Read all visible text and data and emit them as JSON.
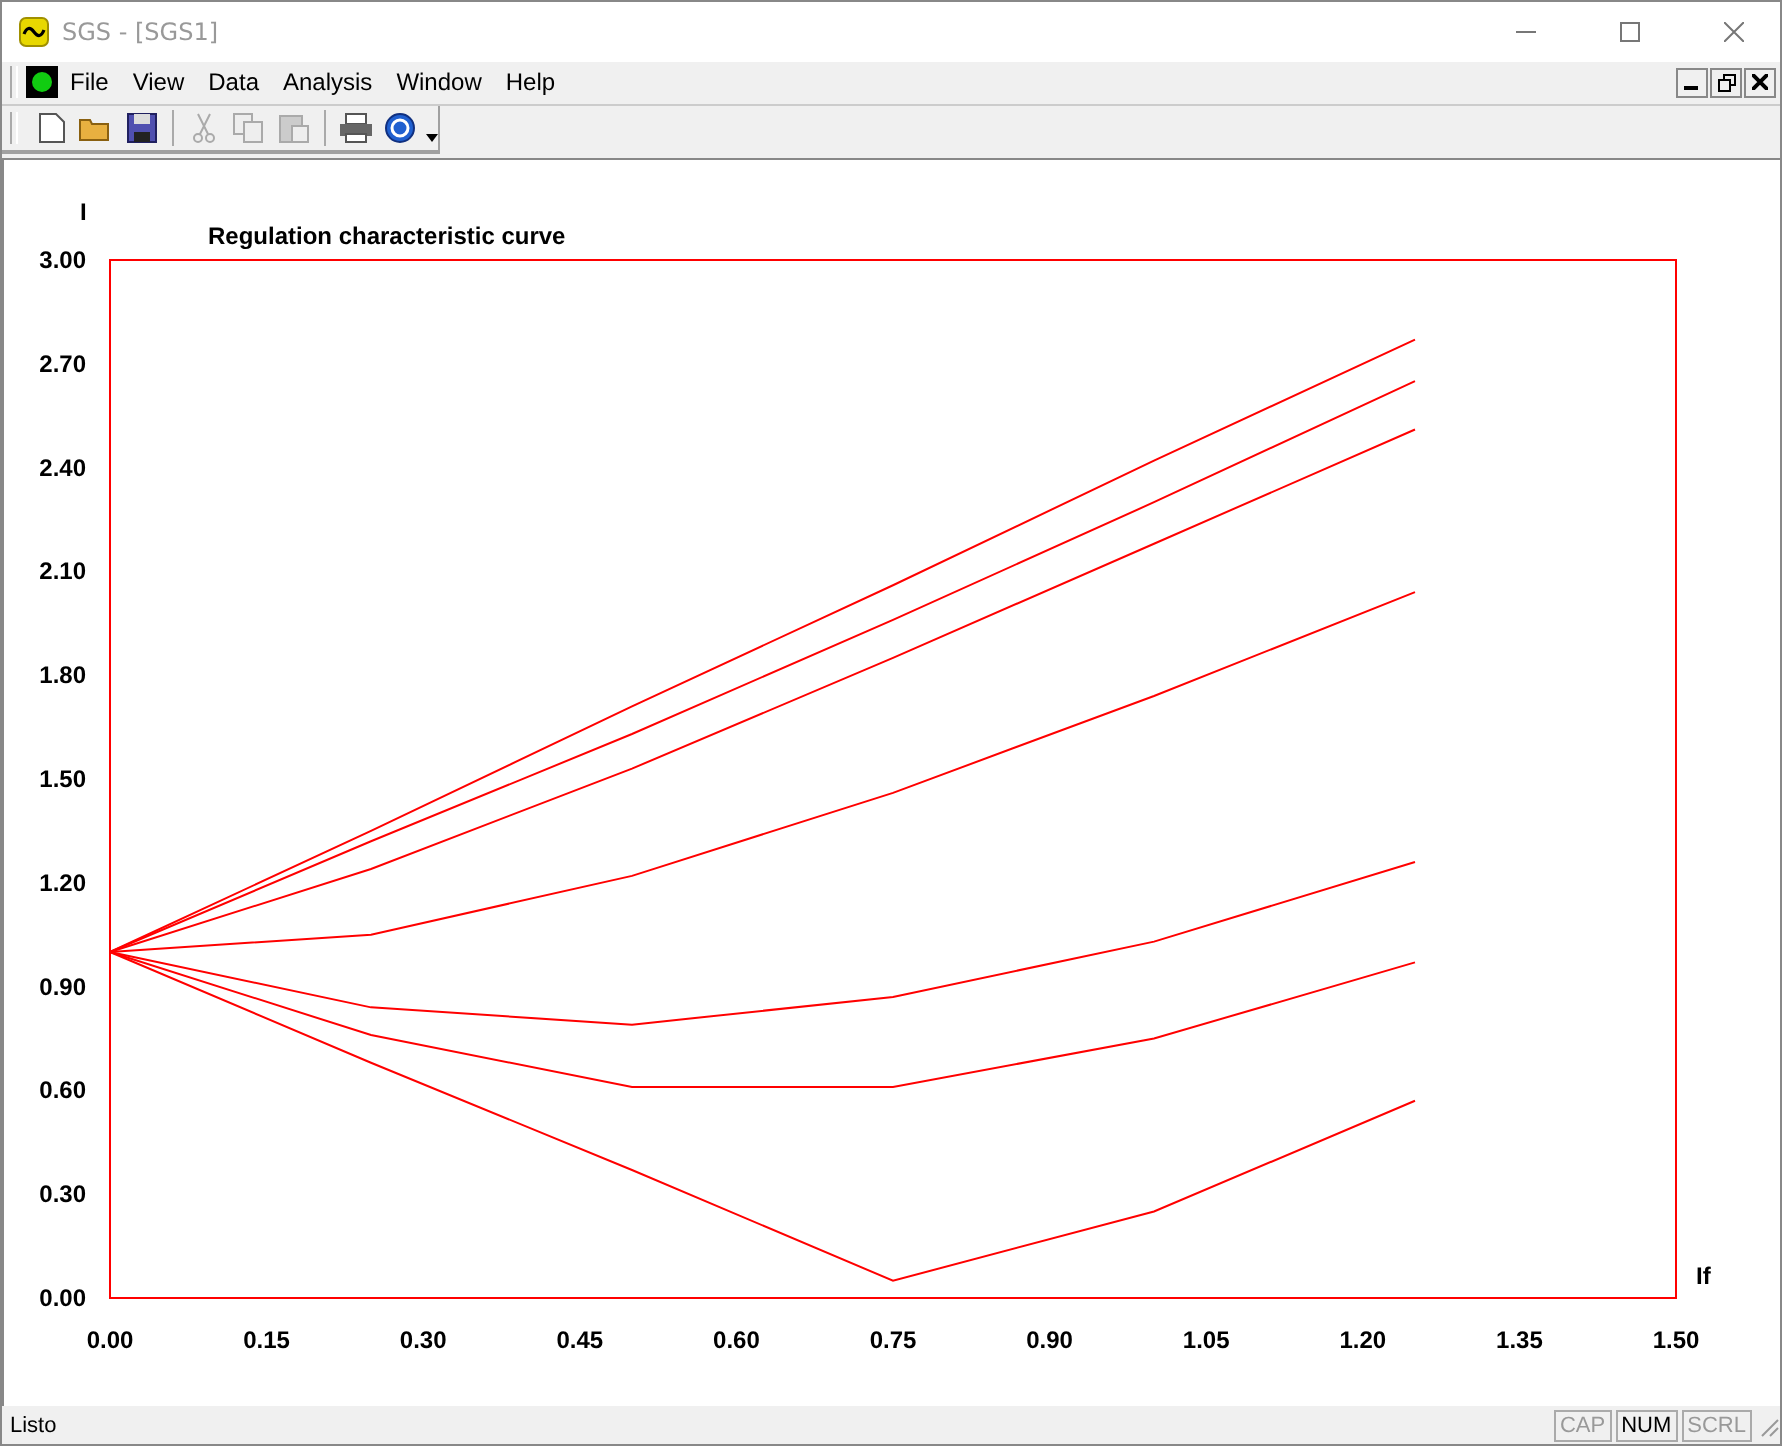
{
  "window": {
    "title": "SGS - [SGS1]"
  },
  "menu": [
    "File",
    "View",
    "Data",
    "Analysis",
    "Window",
    "Help"
  ],
  "chart": {
    "chart_data": {
      "type": "line",
      "title": "Regulation characteristic curve",
      "xlabel": "If",
      "ylabel": "I",
      "x": [
        0,
        0.25,
        0.5,
        0.75,
        1.0,
        1.25
      ],
      "series": [
        {
          "color": "#ff0000",
          "values": [
            1.0,
            1.35,
            1.71,
            2.06,
            2.42,
            2.77
          ]
        },
        {
          "color": "#ff0000",
          "values": [
            1.0,
            1.32,
            1.63,
            1.96,
            2.3,
            2.65
          ]
        },
        {
          "color": "#ff0000",
          "values": [
            1.0,
            1.24,
            1.53,
            1.85,
            2.18,
            2.51
          ]
        },
        {
          "color": "#ff0000",
          "values": [
            1.0,
            1.05,
            1.22,
            1.46,
            1.74,
            2.04
          ]
        },
        {
          "color": "#ff0000",
          "values": [
            1.0,
            0.84,
            0.79,
            0.87,
            1.03,
            1.26
          ]
        },
        {
          "color": "#ff0000",
          "values": [
            1.0,
            0.76,
            0.61,
            0.61,
            0.75,
            0.97
          ]
        },
        {
          "color": "#ff0000",
          "values": [
            1.0,
            0.68,
            0.37,
            0.05,
            0.25,
            0.57
          ]
        }
      ],
      "xlim": [
        0,
        1.5
      ],
      "ylim": [
        0,
        3
      ],
      "xticks": [
        {
          "value": 0,
          "label": "0.00"
        },
        {
          "value": 0.15,
          "label": "0.15"
        },
        {
          "value": 0.3,
          "label": "0.30"
        },
        {
          "value": 0.45,
          "label": "0.45"
        },
        {
          "value": 0.6,
          "label": "0.60"
        },
        {
          "value": 0.75,
          "label": "0.75"
        },
        {
          "value": 0.9,
          "label": "0.90"
        },
        {
          "value": 1.05,
          "label": "1.05"
        },
        {
          "value": 1.2,
          "label": "1.20"
        },
        {
          "value": 1.35,
          "label": "1.35"
        },
        {
          "value": 1.5,
          "label": "1.50"
        }
      ],
      "yticks": [
        {
          "value": 0,
          "label": "0.00"
        },
        {
          "value": 0.3,
          "label": "0.30"
        },
        {
          "value": 0.6,
          "label": "0.60"
        },
        {
          "value": 0.9,
          "label": "0.90"
        },
        {
          "value": 1.2,
          "label": "1.20"
        },
        {
          "value": 1.5,
          "label": "1.50"
        },
        {
          "value": 1.8,
          "label": "1.80"
        },
        {
          "value": 2.1,
          "label": "2.10"
        },
        {
          "value": 2.4,
          "label": "2.40"
        },
        {
          "value": 2.7,
          "label": "2.70"
        },
        {
          "value": 3.0,
          "label": "3.00"
        }
      ]
    }
  },
  "status_bar": {
    "text": "Listo",
    "indicators": [
      {
        "label": "CAP",
        "on": false
      },
      {
        "label": "NUM",
        "on": true
      },
      {
        "label": "SCRL",
        "on": false
      }
    ]
  }
}
